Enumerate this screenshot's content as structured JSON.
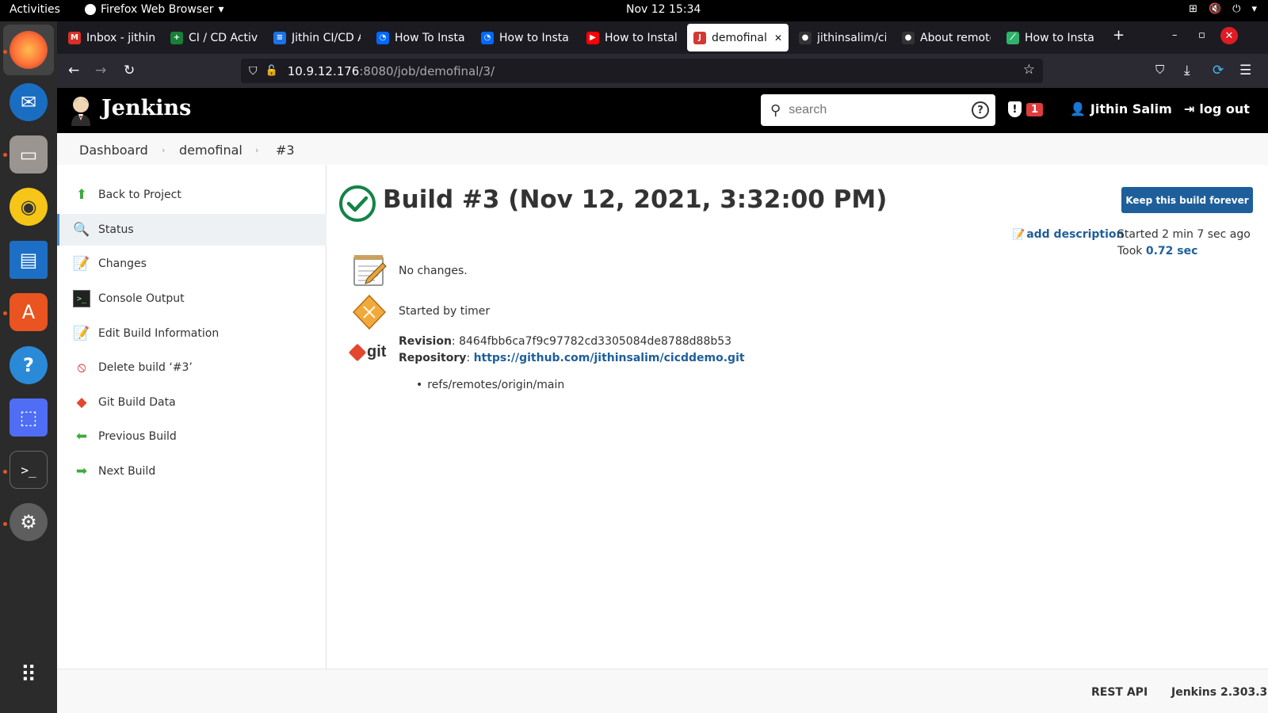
{
  "topbar": {
    "activities": "Activities",
    "app_name": "Firefox Web Browser",
    "clock": "Nov 12  15:34"
  },
  "tabs": [
    {
      "label": "Inbox - jithin.s",
      "favicon": "gmail-icon",
      "color": "#d93025"
    },
    {
      "label": "CI / CD Activit",
      "favicon": "sheets-icon",
      "color": "#188038"
    },
    {
      "label": "Jithin CI/CD A",
      "favicon": "docs-icon",
      "color": "#1a73e8"
    },
    {
      "label": "How To Instal",
      "favicon": "digitalocean-icon",
      "color": "#0069ff"
    },
    {
      "label": "How to Install",
      "favicon": "digitalocean-icon",
      "color": "#0069ff"
    },
    {
      "label": "How to Install",
      "favicon": "youtube-icon",
      "color": "#ff0000"
    },
    {
      "label": "demofinal #",
      "favicon": "jenkins-icon",
      "color": "#d33833"
    },
    {
      "label": "jithinsalim/cic",
      "favicon": "github-icon",
      "color": "#333333"
    },
    {
      "label": "About remote",
      "favicon": "github-icon",
      "color": "#333333"
    },
    {
      "label": "How to Install",
      "favicon": "bitbucket-icon",
      "color": "#2fb36b"
    }
  ],
  "url": {
    "host": "10.9.12.176",
    "path": ":8080/job/demofinal/3/"
  },
  "jenkins": {
    "brand": "Jenkins",
    "search_placeholder": "search",
    "alert_count": "1",
    "user": "Jithin Salim",
    "logout": "log out"
  },
  "breadcrumb": [
    "Dashboard",
    "demofinal",
    "#3"
  ],
  "sidebar": [
    {
      "label": "Back to Project",
      "icon": "up-arrow-icon"
    },
    {
      "label": "Status",
      "icon": "magnifier-icon"
    },
    {
      "label": "Changes",
      "icon": "notepad-icon"
    },
    {
      "label": "Console Output",
      "icon": "terminal-icon"
    },
    {
      "label": "Edit Build Information",
      "icon": "notepad-icon"
    },
    {
      "label": "Delete build ‘#3’",
      "icon": "no-entry-icon"
    },
    {
      "label": "Git Build Data",
      "icon": "git-icon"
    },
    {
      "label": "Previous Build",
      "icon": "left-arrow-icon"
    },
    {
      "label": "Next Build",
      "icon": "right-arrow-icon"
    }
  ],
  "build": {
    "title": "Build #3 (Nov 12, 2021, 3:32:00 PM)",
    "keep_button": "Keep this build forever",
    "add_description": "add description",
    "started": "Started 2 min 7 sec ago",
    "took_label": "Took",
    "took_value": "0.72 sec",
    "changes": "No changes.",
    "cause": "Started by timer",
    "git_label": "git",
    "revision_label": "Revision",
    "revision": "8464fbb6ca7f9c97782cd3305084de8788d88b53",
    "repository_label": "Repository",
    "repository": "https://github.com/jithinsalim/cicddemo.git",
    "branch": "refs/remotes/origin/main"
  },
  "footer": {
    "rest_api": "REST API",
    "version": "Jenkins 2.303.3"
  },
  "colors": {
    "link": "#1e5f9b",
    "success": "#138347",
    "header": "#000000"
  }
}
